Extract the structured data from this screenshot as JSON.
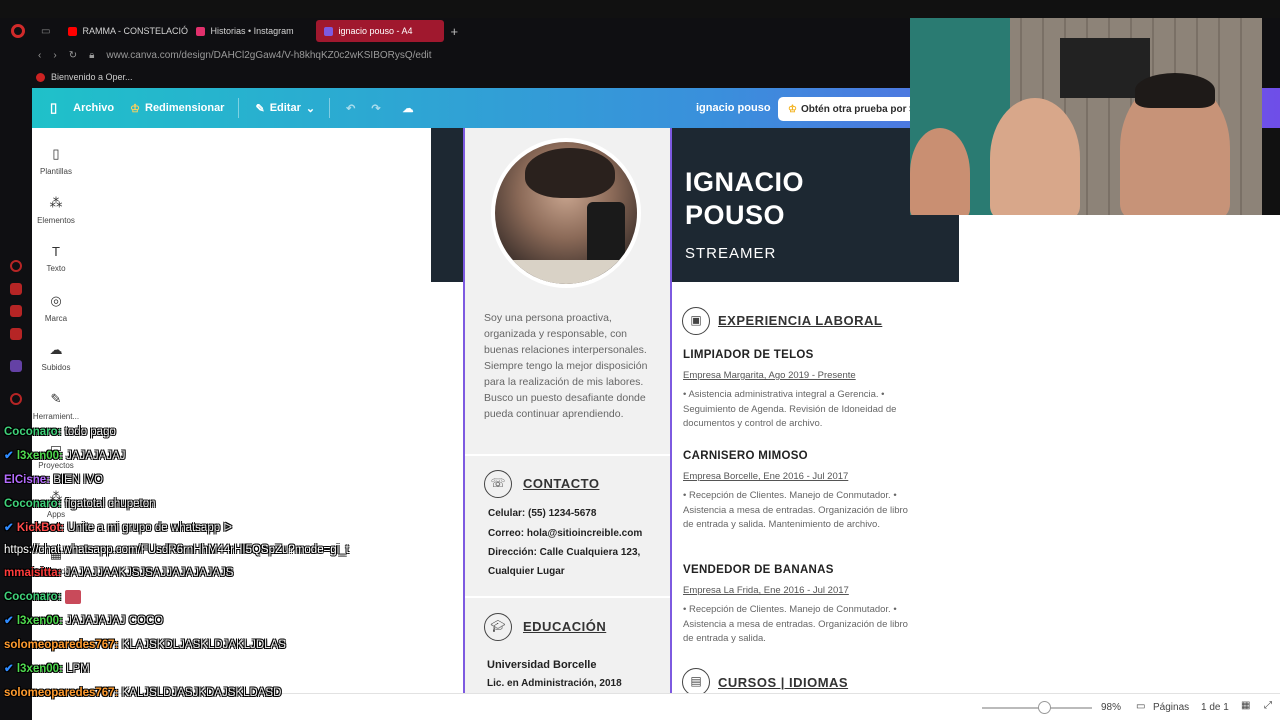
{
  "browser": {
    "tabs": [
      {
        "label": "RAMMA - CONSTELACIÓN",
        "color": "#ff0000"
      },
      {
        "label": "Historias • Instagram",
        "color": "#e1306c"
      },
      {
        "label": "ignacio pouso - A4",
        "color": "#7d5ae0"
      }
    ],
    "url": "www.canva.com/design/DAHCl2gGaw4/V-h8khqKZ0c2wKSIBORysQ/edit",
    "bookmark": "Bienvenido a Oper..."
  },
  "canva": {
    "menu": {
      "file": "Archivo",
      "resize": "Redimensionar",
      "edit": "Editar"
    },
    "doc_name": "ignacio pouso",
    "trial_button": "Obtén otra prueba por $",
    "sidebar": [
      {
        "label": "Plantillas",
        "icon": "▯"
      },
      {
        "label": "Elementos",
        "icon": "⁂"
      },
      {
        "label": "Texto",
        "icon": "T"
      },
      {
        "label": "Marca",
        "icon": "◎"
      },
      {
        "label": "Subidos",
        "icon": "☁"
      },
      {
        "label": "Herramient...",
        "icon": "✎"
      },
      {
        "label": "Proyectos",
        "icon": "▭"
      },
      {
        "label": "Apps",
        "icon": "⁂"
      },
      {
        "label": "Contenido ...",
        "icon": "▦"
      }
    ],
    "zoom": "98%",
    "pages_label": "Páginas",
    "page_count": "1 de 1"
  },
  "resume": {
    "name_line1": "IGNACIO",
    "name_line2": "POUSO",
    "role": "STREAMER",
    "about": "Soy una persona proactiva, organizada y responsable, con buenas relaciones interpersonales. Siempre tengo la mejor disposición para la realización de mis labores. Busco un puesto desafiante donde pueda continuar aprendiendo.",
    "contact_title": "CONTACTO",
    "phone": "Celular: (55) 1234-5678",
    "email": "Correo: hola@sitioincreible.com",
    "address1": "Dirección: Calle Cualquiera 123,",
    "address2": "Cualquier Lugar",
    "education_title": "EDUCACIÓN",
    "university": "Universidad Borcelle",
    "degree": "Lic. en Administración, 2018",
    "experience_title": "EXPERIENCIA LABORAL",
    "jobs": [
      {
        "title": "LIMPIADOR DE TELOS",
        "company": "Empresa Margarita, Ago 2019 - Presente",
        "desc": "• Asistencia administrativa integral a Gerencia. • Seguimiento de Agenda. Revisión de Idoneidad de documentos y control de archivo."
      },
      {
        "title": "CARNISERO MIMOSO",
        "company": "Empresa Borcelle, Ene 2016 - Jul 2017",
        "desc": "• Recepción de Clientes. Manejo de Conmutador. • Asistencia a mesa de entradas. Organización de libro de entrada y salida. Mantenimiento de archivo."
      },
      {
        "title": "VENDEDOR DE BANANAS",
        "company": "Empresa La Frida, Ene 2016 - Jul 2017",
        "desc": "• Recepción de Clientes. Manejo de Conmutador.  • Asistencia a mesa de entradas. Organización de libro de entrada y salida."
      }
    ],
    "courses_title": "CURSOS | IDIOMAS"
  },
  "chat": [
    {
      "user": "Coconaro:",
      "color": "#3fd27a",
      "text": "todo pago"
    },
    {
      "user": "l3xen00:",
      "color": "#4ed94e",
      "text": "JAJAJAJAJ",
      "badge": "✔"
    },
    {
      "user": "ElCisne:",
      "color": "#b56cff",
      "text": "BIEN IVO"
    },
    {
      "user": "Coconaro:",
      "color": "#3fd27a",
      "text": "figatotal chupeton"
    },
    {
      "user": "KickBot:",
      "color": "#ff4b4b",
      "text": "Unite a mi grupo de whatsapp ᐅ",
      "badge": "✔"
    },
    {
      "user": "",
      "color": "#ffffff",
      "text": "https://chat.whatsapp.com/FUsdR6rnHhM44rHI5QSpZu?mode=gi_t",
      "wrap": true
    },
    {
      "user": "mmaisitta:",
      "color": "#ff3b3b",
      "text": "JAJAJJAAKJSJSAJJAJAJAJAJS"
    },
    {
      "user": "Coconaro:",
      "color": "#3fd27a",
      "text": ""
    },
    {
      "user": "l3xen00:",
      "color": "#4ed94e",
      "text": "JAJAJAJAJ COCO",
      "badge": "✔"
    },
    {
      "user": "solomeoparedes767:",
      "color": "#ff9b2f",
      "text": "KLAJSKDLJASKLDJAKLJDLAS"
    },
    {
      "user": "l3xen00:",
      "color": "#4ed94e",
      "text": "LPM",
      "badge": "✔"
    },
    {
      "user": "solomeoparedes767:",
      "color": "#ff9b2f",
      "text": "KALJSLDJASJKDAJSKLDASD"
    }
  ]
}
